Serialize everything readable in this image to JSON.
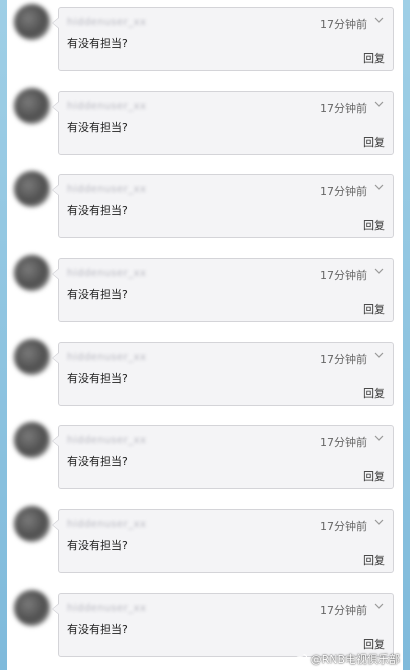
{
  "comments": [
    {
      "username": "hiddenuser_xx",
      "time": "17分钟前",
      "text": "有没有担当?",
      "reply": "回复"
    },
    {
      "username": "hiddenuser_xx",
      "time": "17分钟前",
      "text": "有没有担当?",
      "reply": "回复"
    },
    {
      "username": "hiddenuser_xx",
      "time": "17分钟前",
      "text": "有没有担当?",
      "reply": "回复"
    },
    {
      "username": "hiddenuser_xx",
      "time": "17分钟前",
      "text": "有没有担当?",
      "reply": "回复"
    },
    {
      "username": "hiddenuser_xx",
      "time": "17分钟前",
      "text": "有没有担当?",
      "reply": "回复"
    },
    {
      "username": "hiddenuser_xx",
      "time": "17分钟前",
      "text": "有没有担当?",
      "reply": "回复"
    },
    {
      "username": "hiddenuser_xx",
      "time": "17分钟前",
      "text": "有没有担当?",
      "reply": "回复"
    },
    {
      "username": "hiddenuser_xx",
      "time": "17分钟前",
      "text": "有没有担当?",
      "reply": "回复"
    }
  ],
  "watermark": {
    "icon": "weibo-icon",
    "text": "@RNB电视俱乐部"
  },
  "colors": {
    "bubble_bg": "#f4f4f6",
    "bubble_border": "#d4d4d8",
    "side_bar": "#8fc4e0"
  }
}
